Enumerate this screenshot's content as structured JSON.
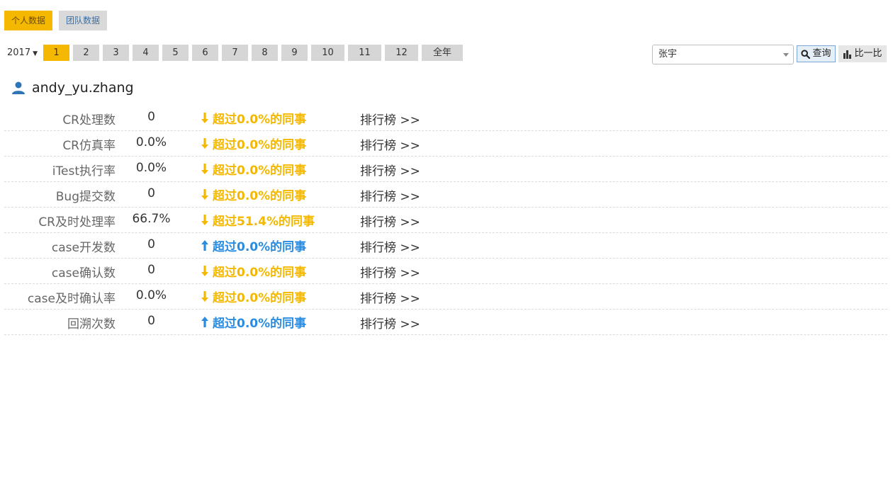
{
  "tabs": [
    {
      "label": "个人数据",
      "active": true
    },
    {
      "label": "团队数据",
      "active": false
    }
  ],
  "filters": {
    "year": "2017",
    "months": [
      {
        "label": "1",
        "active": true
      },
      {
        "label": "2"
      },
      {
        "label": "3"
      },
      {
        "label": "4"
      },
      {
        "label": "5"
      },
      {
        "label": "6"
      },
      {
        "label": "7"
      },
      {
        "label": "8"
      },
      {
        "label": "9"
      },
      {
        "label": "10"
      },
      {
        "label": "11"
      },
      {
        "label": "12"
      },
      {
        "label": "全年"
      }
    ],
    "person": "张宇",
    "query_label": "查询",
    "compare_label": "比一比"
  },
  "user": {
    "name": "andy_yu.zhang"
  },
  "stats": [
    {
      "label": "CR处理数",
      "value": "0",
      "direction": "down",
      "compare": "超过0.0%的同事",
      "rank": "排行榜 >>"
    },
    {
      "label": "CR仿真率",
      "value": "0.0%",
      "direction": "down",
      "compare": "超过0.0%的同事",
      "rank": "排行榜 >>"
    },
    {
      "label": "iTest执行率",
      "value": "0.0%",
      "direction": "down",
      "compare": "超过0.0%的同事",
      "rank": "排行榜 >>"
    },
    {
      "label": "Bug提交数",
      "value": "0",
      "direction": "down",
      "compare": "超过0.0%的同事",
      "rank": "排行榜 >>"
    },
    {
      "label": "CR及时处理率",
      "value": "66.7%",
      "direction": "down",
      "compare": "超过51.4%的同事",
      "rank": "排行榜 >>"
    },
    {
      "label": "case开发数",
      "value": "0",
      "direction": "up",
      "compare": "超过0.0%的同事",
      "rank": "排行榜 >>"
    },
    {
      "label": "case确认数",
      "value": "0",
      "direction": "down",
      "compare": "超过0.0%的同事",
      "rank": "排行榜 >>"
    },
    {
      "label": "case及时确认率",
      "value": "0.0%",
      "direction": "down",
      "compare": "超过0.0%的同事",
      "rank": "排行榜 >>"
    },
    {
      "label": "回溯次数",
      "value": "0",
      "direction": "up",
      "compare": "超过0.0%的同事",
      "rank": "排行榜 >>"
    }
  ],
  "colors": {
    "accent": "#f5b800",
    "up": "#2a8ce0",
    "down": "#f5b800"
  }
}
